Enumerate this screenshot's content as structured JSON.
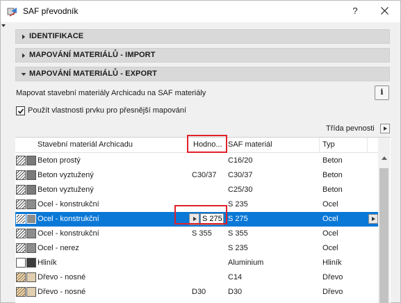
{
  "window": {
    "title": "SAF převodník",
    "help_label": "?",
    "icon": "saf-app-icon"
  },
  "sections": [
    {
      "label": "IDENTIFIKACE",
      "expanded": false
    },
    {
      "label": "MAPOVÁNÍ MATERIÁLŮ - IMPORT",
      "expanded": false
    },
    {
      "label": "MAPOVÁNÍ MATERIÁLŮ - EXPORT",
      "expanded": true
    }
  ],
  "export": {
    "description": "Mapovat stavební materiály Archicadu na SAF materiály",
    "info_label": "i",
    "checkbox_label": "Použít vlastnosti prvku pro přesnější mapování",
    "checkbox_checked": true,
    "strength_class_label": "Třída pevnosti"
  },
  "table": {
    "columns": [
      "Stavební materiál Archicadu",
      "Hodno...",
      "SAF materiál",
      "Typ"
    ],
    "rows": [
      {
        "name": "Beton prostý",
        "value": "",
        "saf": "C16/20",
        "type": "Beton",
        "hatch": "diag",
        "color": "#7a7a7a"
      },
      {
        "name": "Beton vyztužený",
        "value": "C30/37",
        "saf": "C30/37",
        "type": "Beton",
        "hatch": "diag",
        "color": "#7a7a7a"
      },
      {
        "name": "Beton vyztužený",
        "value": "",
        "saf": "C25/30",
        "type": "Beton",
        "hatch": "diag",
        "color": "#7a7a7a"
      },
      {
        "name": "Ocel - konstrukční",
        "value": "",
        "saf": "S 235",
        "type": "Ocel",
        "hatch": "diag",
        "color": "#8d8d8d"
      },
      {
        "name": "Ocel - konstrukční",
        "value": "S 275",
        "saf": "S 275",
        "type": "Ocel",
        "hatch": "diag",
        "color": "#8d8d8d",
        "selected": true
      },
      {
        "name": "Ocel - konstrukční",
        "value": "S 355",
        "saf": "S 355",
        "type": "Ocel",
        "hatch": "diag",
        "color": "#8d8d8d"
      },
      {
        "name": "Ocel - nerez",
        "value": "",
        "saf": "S 235",
        "type": "Ocel",
        "hatch": "diag",
        "color": "#8d8d8d"
      },
      {
        "name": "Hliník",
        "value": "",
        "saf": "Aluminium",
        "type": "Hliník",
        "hatch": "blank",
        "color": "#3c3c3c"
      },
      {
        "name": "Dřevo - nosné",
        "value": "",
        "saf": "C14",
        "type": "Dřevo",
        "hatch": "wood",
        "color": "#e0cfb0"
      },
      {
        "name": "Dřevo - nosné",
        "value": "D30",
        "saf": "D30",
        "type": "Dřevo",
        "hatch": "wood",
        "color": "#e0cfb0"
      }
    ]
  },
  "colors": {
    "selection": "#0a78d7",
    "highlight_box": "#e0212b",
    "section_header": "#d9d9d9"
  }
}
